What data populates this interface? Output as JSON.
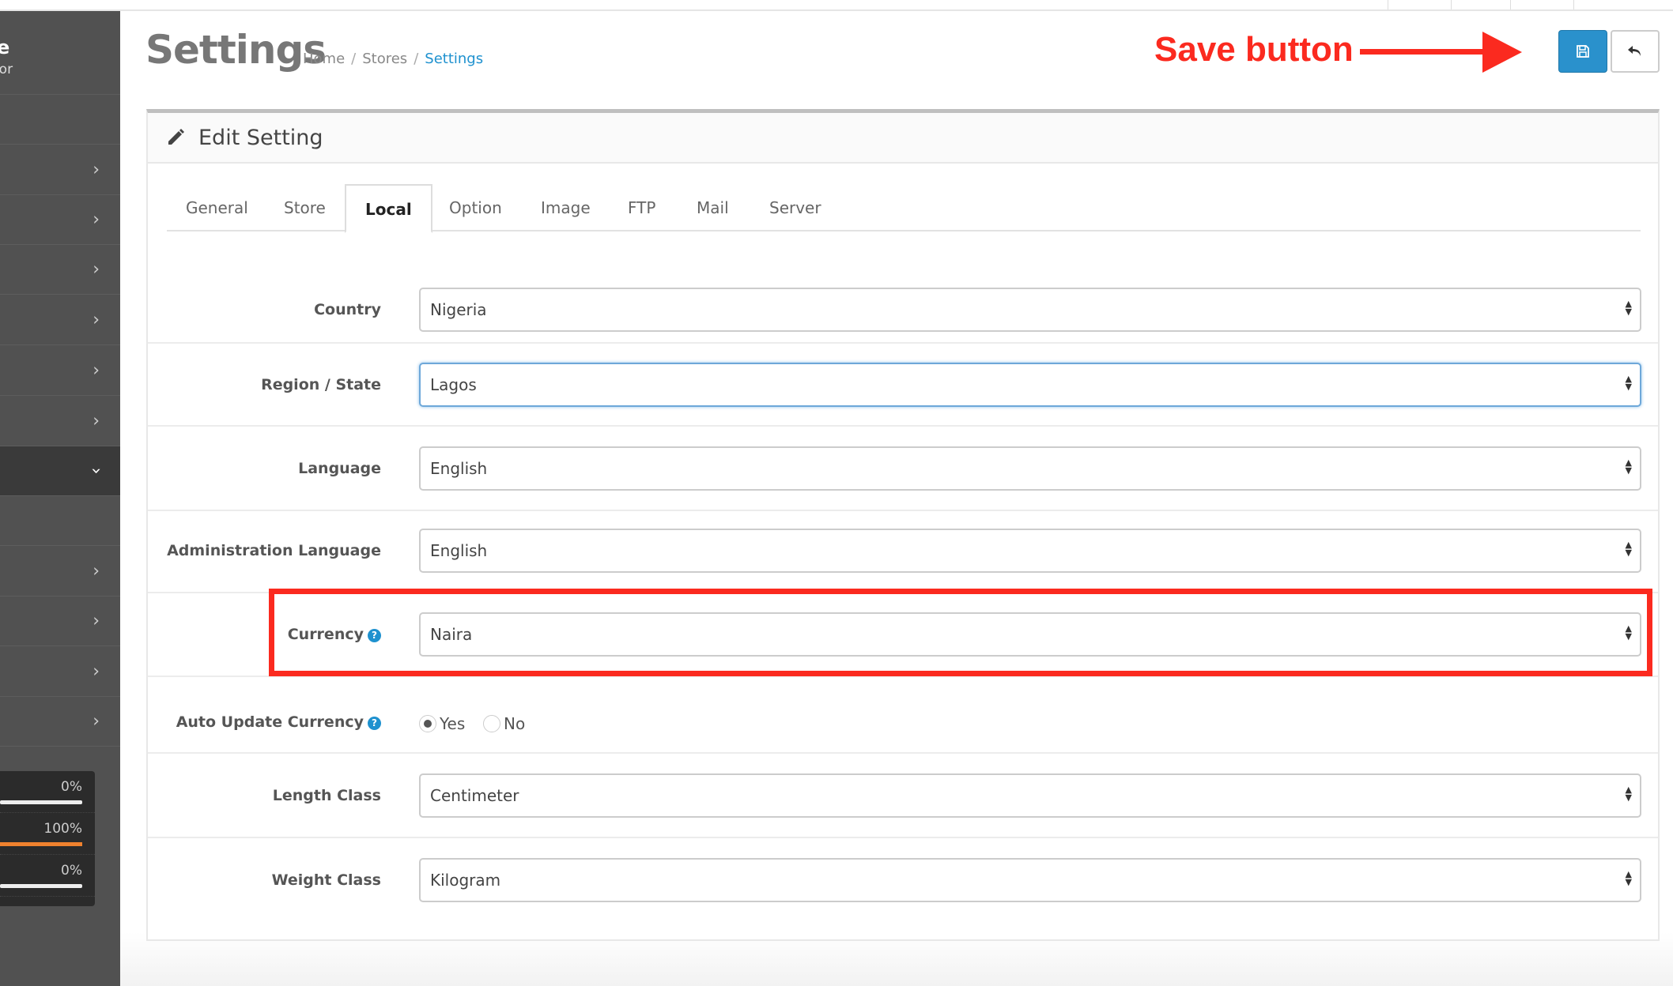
{
  "sidebar": {
    "profile_name_fragment": "e",
    "profile_role_fragment": "tor",
    "items": [
      {
        "icon": "chevron-right-icon",
        "expanded": false
      },
      {
        "icon": "chevron-right-icon",
        "expanded": false
      },
      {
        "icon": "chevron-right-icon",
        "expanded": false
      },
      {
        "icon": "chevron-right-icon",
        "expanded": false
      },
      {
        "icon": "chevron-right-icon",
        "expanded": false
      },
      {
        "icon": "chevron-right-icon",
        "expanded": false
      },
      {
        "icon": "chevron-down-icon",
        "expanded": true
      },
      {
        "icon": "none",
        "expanded": false
      },
      {
        "icon": "chevron-right-icon",
        "expanded": false
      },
      {
        "icon": "chevron-right-icon",
        "expanded": false
      },
      {
        "icon": "chevron-right-icon",
        "expanded": false
      },
      {
        "icon": "chevron-right-icon",
        "expanded": false
      }
    ],
    "progress": [
      {
        "label": "0%",
        "value": 0,
        "color": "#eeeeee"
      },
      {
        "label": "100%",
        "value": 100,
        "color": "#f0822e"
      },
      {
        "label": "0%",
        "value": 0,
        "color": "#eeeeee"
      }
    ]
  },
  "header": {
    "title": "Settings",
    "breadcrumb": [
      "Home",
      "Stores",
      "Settings"
    ],
    "save_icon": "floppy-disk-icon",
    "back_icon": "reply-icon",
    "annotation": "Save button",
    "accent": "#2a91cc",
    "annotation_color": "#fb2a1f"
  },
  "panel": {
    "title": "Edit Setting",
    "tabs": [
      "General",
      "Store",
      "Local",
      "Option",
      "Image",
      "FTP",
      "Mail",
      "Server"
    ],
    "active_tab": "Local",
    "fields": {
      "country": {
        "label": "Country",
        "value": "Nigeria"
      },
      "region": {
        "label": "Region / State",
        "value": "Lagos"
      },
      "language": {
        "label": "Language",
        "value": "English"
      },
      "admin_language": {
        "label": "Administration Language",
        "value": "English"
      },
      "currency": {
        "label": "Currency",
        "value": "Naira",
        "help": "?"
      },
      "auto_update": {
        "label": "Auto Update Currency",
        "help": "?",
        "options": [
          "Yes",
          "No"
        ],
        "selected": "Yes"
      },
      "length_class": {
        "label": "Length Class",
        "value": "Centimeter"
      },
      "weight_class": {
        "label": "Weight Class",
        "value": "Kilogram"
      }
    }
  }
}
